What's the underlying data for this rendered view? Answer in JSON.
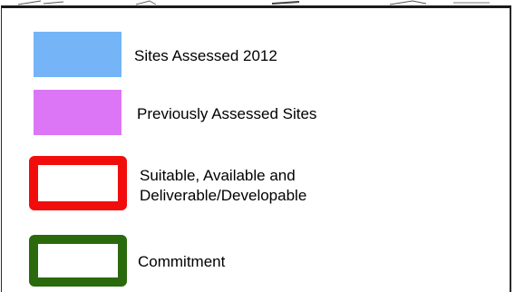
{
  "legend": {
    "items": [
      {
        "label": "Sites Assessed 2012",
        "style": "filled",
        "color": "#74b4f7"
      },
      {
        "label": "Previously Assessed Sites",
        "style": "filled",
        "color": "#dc76f7"
      },
      {
        "label": "Suitable, Available and",
        "label_line2": "Deliverable/Developable",
        "style": "outline",
        "color": "#f20d0d"
      },
      {
        "label": "Commitment",
        "style": "outline",
        "color": "#2a6a0c"
      }
    ]
  }
}
